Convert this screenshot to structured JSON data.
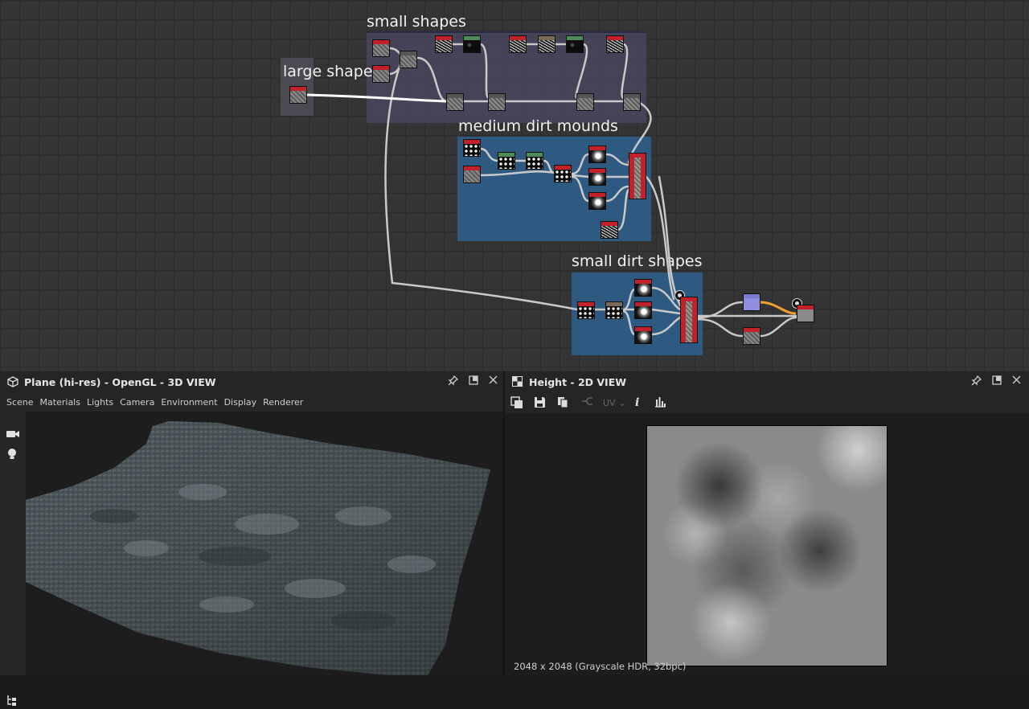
{
  "graph": {
    "frames": {
      "small_shapes": "small shapes",
      "large_shape": "large shape",
      "medium_dirt_mounds": "medium dirt mounds",
      "small_dirt_shapes": "small dirt shapes"
    },
    "colors": {
      "frame_purple": "#46445a",
      "frame_blue": "#2e5a82",
      "frame_gray": "#4a4a52",
      "node_header_red": "#c3212a",
      "node_header_green": "#4f8a5a",
      "link_color": "#c9c9c9",
      "link_highlight": "#ffffff",
      "link_orange": "#f0a030"
    }
  },
  "panel3d": {
    "title": "Plane (hi-res) - OpenGL - 3D VIEW",
    "icon": "cube-icon",
    "menu": [
      "Scene",
      "Materials",
      "Lights",
      "Camera",
      "Environment",
      "Display",
      "Renderer"
    ],
    "sidebar_icons": [
      "camera-icon",
      "light-bulb-icon",
      "scene-tree-icon"
    ]
  },
  "panel2d": {
    "title": "Height - 2D VIEW",
    "icon": "checker-icon",
    "toolbar_icons": [
      "copy-icon",
      "save-icon",
      "duplicate-icon",
      "tiling-icon",
      "info-icon",
      "histogram-icon"
    ],
    "uv_label": "UV",
    "status": "2048 x 2048 (Grayscale HDR, 32bpc)"
  }
}
